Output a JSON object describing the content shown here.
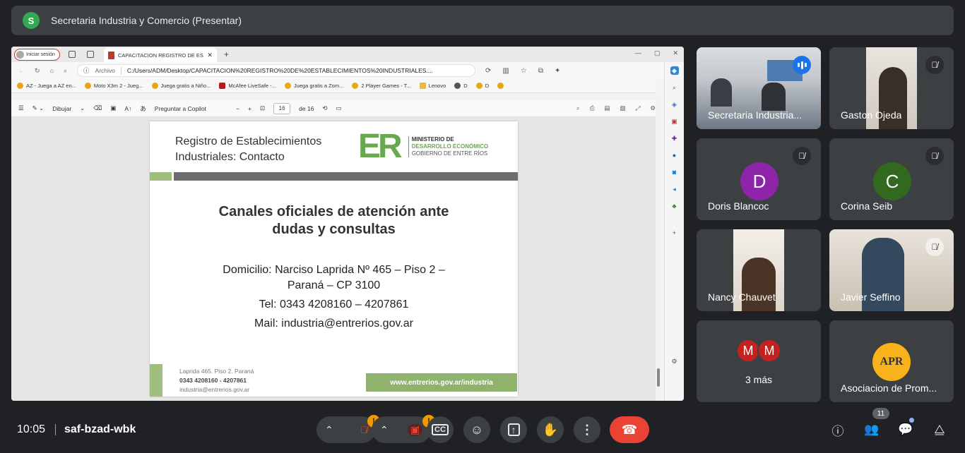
{
  "header": {
    "avatar_letter": "S",
    "title": "Secretaria Industria y Comercio (Presentar)"
  },
  "browser": {
    "signin_label": "Iniciar sesión",
    "tab_title": "CAPACITACION REGISTRO DE ES",
    "address_prefix": "Archivo",
    "url": "C:/Users/ADM/Desktop/CAPACITACION%20REGISTRO%20DE%20ESTABLECIMIENTOS%20INDUSTRIALES....",
    "bookmarks": [
      "AZ - Juega a AZ en...",
      "Moto X3m 2 - Jueg...",
      "Juega gratis a Niño...",
      "McAfee LiveSafe -...",
      "Juega gratis a Zom...",
      "2 Player Games - T...",
      "Lenovo",
      "D",
      "D"
    ]
  },
  "pdf_toolbar": {
    "draw_label": "Dibujar",
    "copilot_label": "Preguntar a Copilot",
    "page_current": "16",
    "page_total": "de 16"
  },
  "slide": {
    "heading_line1": "Registro de Establecimientos",
    "heading_line2": "Industriales: Contacto",
    "logo_mark": "ER",
    "logo_line1": "MINISTERIO DE",
    "logo_line2": "DESARROLLO ECONÓMICO",
    "logo_line3": "GOBIERNO DE ENTRE RÍOS",
    "main_line1": "Canales oficiales de atención ante",
    "main_line2": "dudas y consultas",
    "address_line1": "Domicilio: Narciso Laprida Nº 465 – Piso 2 –",
    "address_line2": "Paraná – CP 3100",
    "tel": "Tel: 0343 4208160 – 4207861",
    "mail": "Mail: industria@entrerios.gov.ar",
    "footer_addr": "Laprida  465. Piso 2. Paraná",
    "footer_phone": "0343 4208160 - 4207861",
    "footer_mail": "industria@entrerios.gov.ar",
    "footer_url": "www.entrerios.gov.ar/industria"
  },
  "participants": [
    {
      "name": "Secretaria Industria...",
      "type": "video",
      "status": "speaking"
    },
    {
      "name": "Gaston Ojeda",
      "type": "video",
      "status": "muted"
    },
    {
      "name": "Doris Blancoc",
      "type": "avatar",
      "letter": "D",
      "color": "#8e24aa",
      "status": "muted"
    },
    {
      "name": "Corina Seib",
      "type": "avatar",
      "letter": "C",
      "color": "#33691e",
      "status": "muted"
    },
    {
      "name": "Nancy Chauvet",
      "type": "video",
      "status": "none"
    },
    {
      "name": "Javier Seffino",
      "type": "video",
      "status": "muted"
    },
    {
      "name": "3 más",
      "type": "more",
      "letters": [
        "M",
        "M"
      ]
    },
    {
      "name": "Asociacion de Prom...",
      "type": "logo",
      "logo_text": "APR",
      "status": "none"
    }
  ],
  "bottom": {
    "time": "10:05",
    "meeting_code": "saf-bzad-wbk",
    "warn_mark": "!",
    "people_count": "11"
  }
}
